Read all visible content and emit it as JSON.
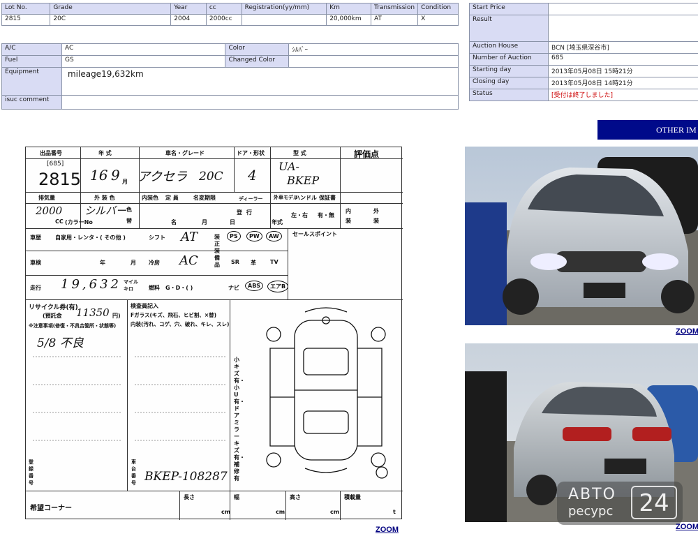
{
  "top_table": {
    "headers": [
      "Lot No.",
      "Grade",
      "Year",
      "cc",
      "Registration(yy/mm)",
      "Km",
      "Transmission",
      "Condition"
    ],
    "values": [
      "2815",
      "20C",
      "2004",
      "2000cc",
      "",
      "20,000km",
      "AT",
      "X"
    ]
  },
  "details": {
    "ac_label": "A/C",
    "ac_value": "AC",
    "color_label": "Color",
    "color_value": "ｼﾙﾊﾞｰ",
    "fuel_label": "Fuel",
    "fuel_value": "GS",
    "changed_color_label": "Changed Color",
    "changed_color_value": "",
    "equipment_label": "Equipment",
    "equipment_value": "mileage19,632km",
    "isuc_label": "isuc comment",
    "isuc_value": ""
  },
  "auction": {
    "start_price_label": "Start Price",
    "start_price_value": "",
    "result_label": "Result",
    "result_value": "",
    "house_label": "Auction House",
    "house_value": "BCN [埼玉県深谷市]",
    "number_label": "Number of Auction",
    "number_value": "685",
    "starting_label": "Starting day",
    "starting_value": "2013年05月08日 15時21分",
    "closing_label": "Closing day",
    "closing_value": "2013年05月08日 14時21分",
    "status_label": "Status",
    "status_value": "[受付は終了しました]"
  },
  "other_images_label": "OTHER IM",
  "zoom_label": "ZOOM",
  "sheet": {
    "h_lot": "出品番号",
    "h_year": "年 式",
    "h_model": "車名・グレード",
    "h_doors": "ドア・形状",
    "h_type": "型 式",
    "h_score": "評価点",
    "lot_small": "[685]",
    "lot": "2815",
    "year": "16",
    "month": "9",
    "month_unit": "月",
    "model": "アクセラ",
    "grade": "20C",
    "doors": "4",
    "type1": "UA-",
    "type2": "BKEP",
    "h_cc": "排気量",
    "h_exterior": "外 装 色",
    "h_changed": "内装色",
    "h_capacity": "定 員",
    "h_inspection": "名変期限",
    "h_dealer": "ディーラー",
    "h_import": "外車モデル",
    "h_handle": "ハンドル",
    "h_warranty": "保証書",
    "cc_value": "2000",
    "color_hand": "シルバー",
    "cc_label": "CC",
    "colorno_label": "(カラーNo",
    "iro": "色",
    "hen": "替",
    "mei": "名",
    "tsuki": "月",
    "hi": "日",
    "handle_lr": "左・右",
    "warranty_yn": "有・無",
    "nai": "内",
    "gai": "外",
    "sou1": "装",
    "sou2": "装",
    "toku": "登",
    "gyo": "行",
    "nenshiki": "年式",
    "r_vehicle": "車歴",
    "r_vehicle_opts": "自家用・レンタ・(     その他  )",
    "r_shift": "シフト",
    "r_shift_val": "AT",
    "r_equipment": "装 正 装 備 品",
    "opt_ps": "PS",
    "opt_pw": "PW",
    "opt_aw": "AW",
    "opt_sr": "SR",
    "opt_gawa": "革",
    "opt_tv": "TV",
    "opt_navi": "ナビ",
    "opt_abs": "ABS",
    "opt_air": "エアB",
    "sales_point": "セールスポイント",
    "r_inspect": "車検",
    "r_nen": "年",
    "r_tsuki": "月",
    "r_aircon": "冷房",
    "r_aircon_val": "AC",
    "r_mileage": "走行",
    "mileage_hand": "19,632",
    "mileage_unit": "マイル キロ",
    "r_fuel": "燃料",
    "r_fuel_opts": "G・D・(     )",
    "recycle": "リサイクル券(有)",
    "deposit": "(預託金",
    "deposit_val": "11350",
    "deposit_unit": "円)",
    "notes_head": "※注意事項(修復・不具合箇所・状態等)",
    "notes_hand": "5/8 不良",
    "inspector_head": "検査員記入",
    "inspector_1": "Fガラス(キズ、飛石、ヒビ割、×替)",
    "inspector_2": "内装(汚れ、コゲ、穴、破れ、キレ、スレ)",
    "vertical_note": "小キズ有・小U有・ドアミラーキズ有・補修有",
    "reg_no": "登録番号",
    "frame_no_label": "車台番号",
    "frame_no": "BKEP-108287",
    "corner": "希望コーナー",
    "length": "長さ",
    "width": "幅",
    "height": "高さ",
    "load": "積載量",
    "cm1": "cm",
    "cm2": "cm",
    "cm3": "cm",
    "t": "t"
  },
  "photos": [
    {
      "name": "front view",
      "icon": "car-photo-front"
    },
    {
      "name": "rear view",
      "icon": "car-photo-rear"
    }
  ],
  "watermark": {
    "line1": "АВТО",
    "line2": "ресурс",
    "digits": "24"
  },
  "colors": {
    "label_bg": "#d9dcf4",
    "banner": "#000a8a",
    "zoom": "#000080",
    "status": "#cc0000",
    "border": "#8a93a8"
  }
}
